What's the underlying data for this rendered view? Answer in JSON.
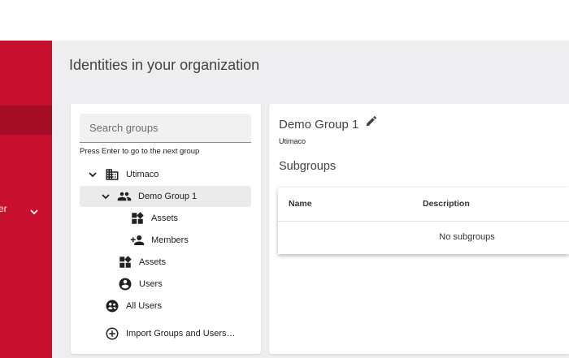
{
  "sidebar": {
    "item_fragment": "er"
  },
  "page": {
    "title": "Identities in your organization"
  },
  "groups_panel": {
    "search_placeholder": "Search groups",
    "hint": "Press Enter to go to the next group",
    "tree": {
      "root": "Utimaco",
      "group": "Demo Group 1",
      "group_assets": "Assets",
      "group_members": "Members",
      "assets": "Assets",
      "users": "Users",
      "all_users": "All Users",
      "import": "Import Groups and Users…"
    }
  },
  "detail": {
    "title": "Demo Group 1",
    "subtitle": "Utimaco",
    "subgroups_title": "Subgroups",
    "table": {
      "columns": [
        "Name",
        "Description"
      ],
      "empty_text": "No subgroups"
    }
  },
  "colors": {
    "brand": "#c8102e",
    "brand_active": "#a50d26",
    "background": "#eeeef0"
  }
}
